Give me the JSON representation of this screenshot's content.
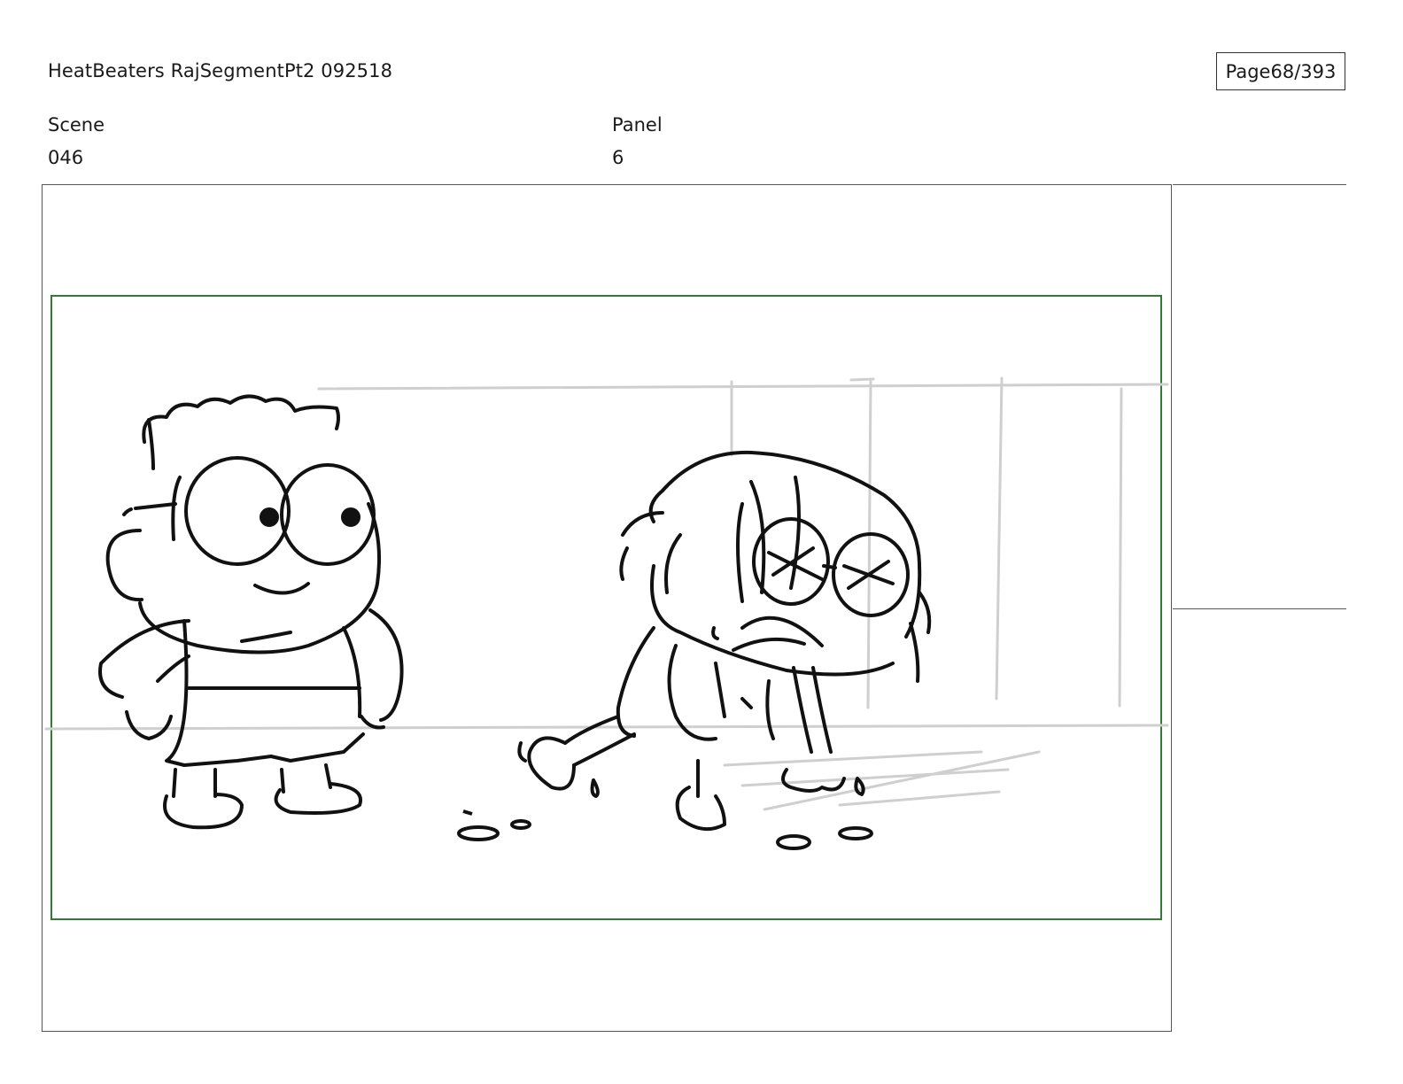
{
  "header": {
    "title": "HeatBeaters RajSegmentPt2 092518",
    "page_label": "Page",
    "page_number": "68/393"
  },
  "fields": {
    "scene_label": "Scene",
    "scene_value": "046",
    "panel_label": "Panel",
    "panel_value": "6"
  },
  "colors": {
    "safe_frame": "#2e7d32",
    "ink": "#111111",
    "background_lines": "#cfcfcf"
  }
}
